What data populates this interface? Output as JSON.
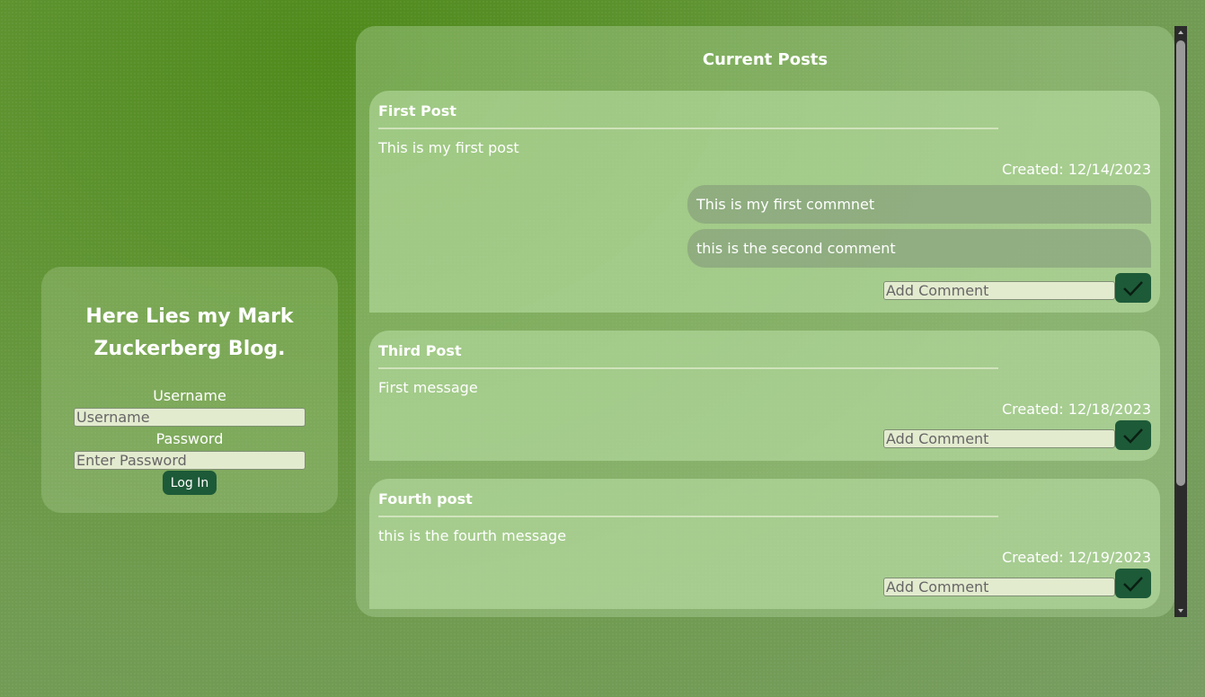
{
  "login": {
    "title": "Here Lies my Mark Zuckerberg Blog.",
    "username_label": "Username",
    "username_placeholder": "Username",
    "password_label": "Password",
    "password_placeholder": "Enter Password",
    "login_button": "Log In"
  },
  "posts_panel": {
    "title": "Current Posts",
    "comment_placeholder": "Add Comment",
    "submit_icon": "checkmark-icon",
    "posts": [
      {
        "title": "First Post",
        "body": "This is my first post",
        "created": "Created: 12/14/2023",
        "comments": [
          "This is my first commnet",
          "this is the second comment"
        ]
      },
      {
        "title": "Third Post",
        "body": "First message",
        "created": "Created: 12/18/2023",
        "comments": []
      },
      {
        "title": "Fourth post",
        "body": "this is the fourth message",
        "created": "Created: 12/19/2023",
        "comments": []
      }
    ]
  },
  "colors": {
    "button": "#1d5a38",
    "input_background": "#e3ebcf"
  }
}
